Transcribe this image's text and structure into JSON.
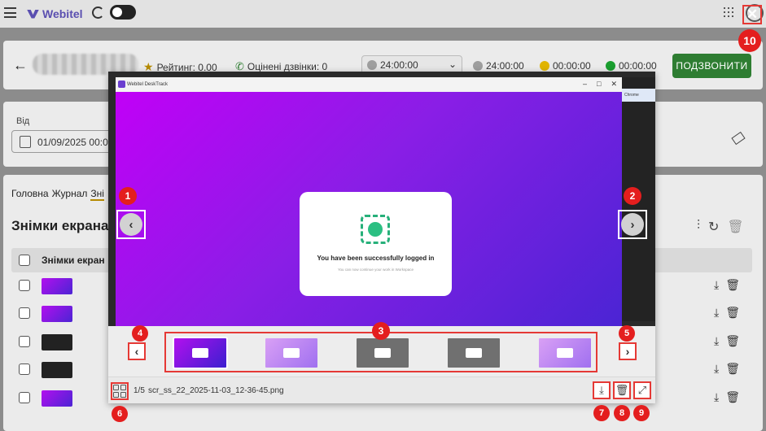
{
  "app": {
    "brand": "Webitel"
  },
  "header": {
    "rating_label": "Рейтинг: 0.00",
    "rated_calls_label": "Оцінені дзвінки: 0",
    "time_select_value": "24:00:00",
    "status_times": [
      "24:00:00",
      "00:00:00",
      "00:00:00"
    ],
    "status_colors": [
      "#9e9e9e",
      "#e0b400",
      "#1a9e2f"
    ],
    "call_button": "ПОДЗВОНИТИ"
  },
  "filters": {
    "from_label": "Від",
    "from_value": "01/09/2025 00:00"
  },
  "tabs": [
    "Головна",
    "Журнал",
    "Зні"
  ],
  "section": {
    "title": "Знімки екрана",
    "column_title": "Знімки екран"
  },
  "viewer": {
    "window_title": "Webitel DeskTrack",
    "browser_label": "Chrome",
    "login_title": "You have been successfully logged in",
    "login_subtitle": "You can now continue your work in Workspace",
    "counter": "1/5",
    "filename": "scr_ss_22_2025-11-03_12-36-45.png"
  },
  "annotations": [
    "1",
    "2",
    "3",
    "4",
    "5",
    "6",
    "7",
    "8",
    "9",
    "10"
  ],
  "icons": {
    "prev": "chevron-left-icon",
    "next": "chevron-right-icon",
    "download": "download-icon",
    "delete": "trash-icon",
    "fullscreen": "expand-icon",
    "close": "close-icon",
    "grid": "grid-icon"
  }
}
